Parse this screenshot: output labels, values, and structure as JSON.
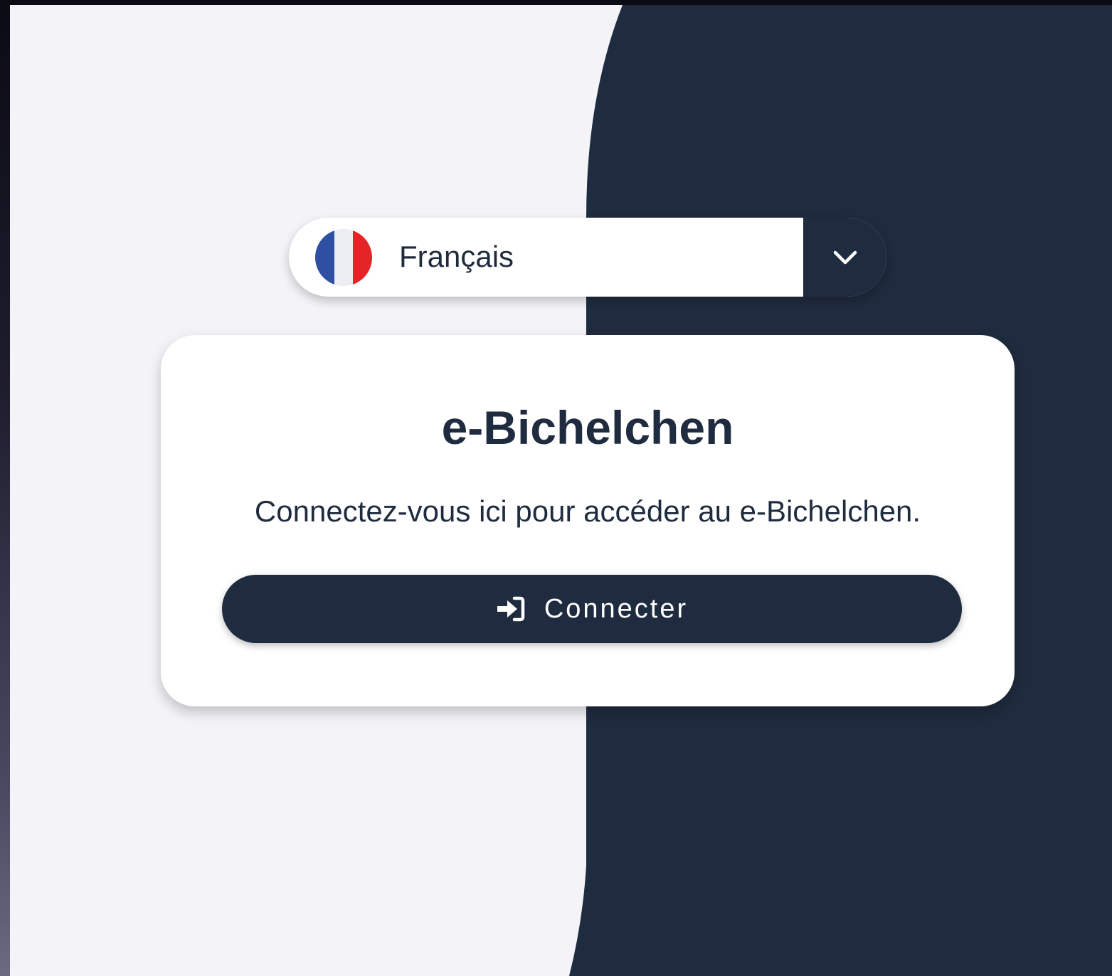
{
  "language_select": {
    "selected_label": "Français",
    "flag_icon": "france-flag-icon",
    "toggle_icon": "chevron-down-icon"
  },
  "card": {
    "title": "e-Bichelchen",
    "description": "Connectez-vous ici pour accéder au e-Bichelchen.",
    "login_button": {
      "label": "Connecter",
      "icon": "sign-in-icon"
    }
  },
  "colors": {
    "navy": "#1f2b3e",
    "light_background": "#f4f4f8",
    "card_background": "#ffffff",
    "flag_blue": "#2f4fa2",
    "flag_white": "#eceef3",
    "flag_red": "#e52427"
  }
}
